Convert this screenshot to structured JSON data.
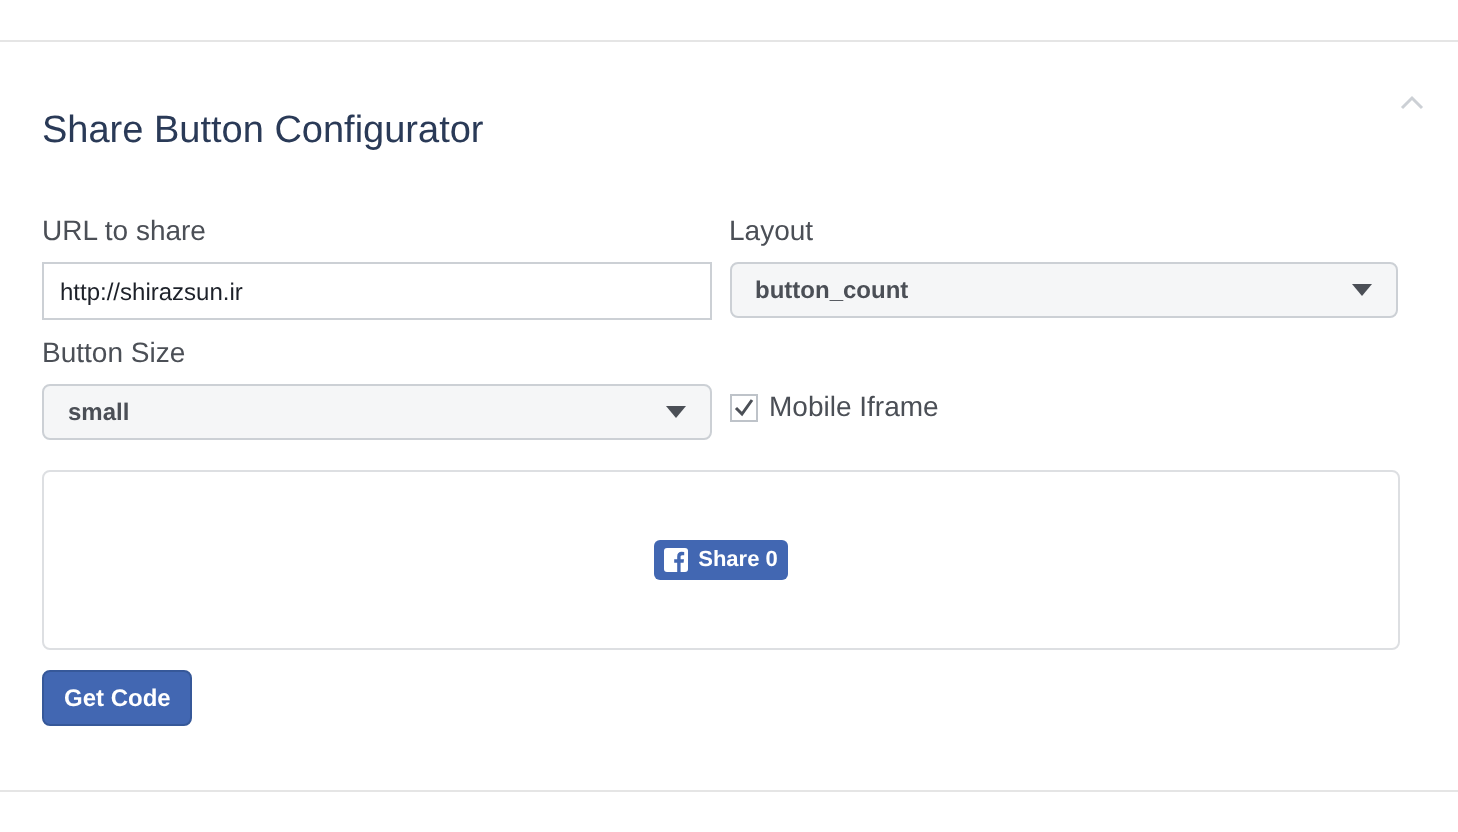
{
  "panel": {
    "title": "Share Button Configurator",
    "expanded": true
  },
  "url_field": {
    "label": "URL to share",
    "value": "http://shirazsun.ir"
  },
  "layout_select": {
    "label": "Layout",
    "value": "button_count"
  },
  "size_select": {
    "label": "Button Size",
    "value": "small"
  },
  "mobile_iframe": {
    "label": "Mobile Iframe",
    "checked": true
  },
  "preview": {
    "share_button": "Share 0"
  },
  "get_code_button": "Get Code"
}
